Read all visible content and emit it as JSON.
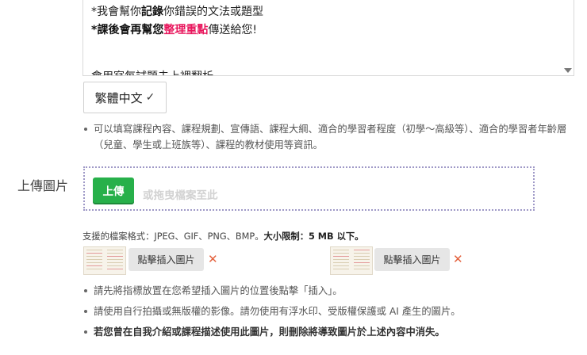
{
  "editor": {
    "line1_prefix": "*我會幫你",
    "line1_bold": "記錄",
    "line1_suffix": "你錯誤的文法或題型",
    "line2_prefix": "*課後會再幫您",
    "line2_highlight": "整理重點",
    "line2_suffix": "傳送給您!",
    "line3_partial": "會用寫每試題去上裡翻析"
  },
  "language": {
    "selected": "繁體中文",
    "check_glyph": "✓"
  },
  "tips_top": [
    "可以填寫課程內容、課程規劃、宣傳語、課程大綱、適合的學習者程度（初學～高級等）、適合的學習者年齡層（兒童、學生或上班族等）、課程的教材使用等資訊。"
  ],
  "upload": {
    "label": "上傳圖片",
    "button": "上傳",
    "drop_hint": "或拖曳檔案至此",
    "formats_text": "支援的檔案格式：JPEG、GIF、PNG、BMP。",
    "size_limit": "大小限制：5 MB 以下。",
    "images": [
      {
        "insert_label": "點擊插入圖片",
        "delete_icon": "✕"
      },
      {
        "insert_label": "點擊插入圖片",
        "delete_icon": "✕"
      }
    ]
  },
  "tips_bottom": [
    "請先將指標放置在您希望插入圖片的位置後點擊「插入」。",
    "請使用自行拍攝或無版權的影像。請勿使用有浮水印、受版權保護或 AI 產生的圖片。",
    "若您曾在自我介紹或課程描述使用此圖片，則刪除將導致圖片於上述內容中消失。"
  ],
  "colors": {
    "accent_green": "#27b04a",
    "highlight_pink": "#e8175d",
    "dropzone_border": "#9f99c7",
    "delete_red": "#e4623e"
  }
}
